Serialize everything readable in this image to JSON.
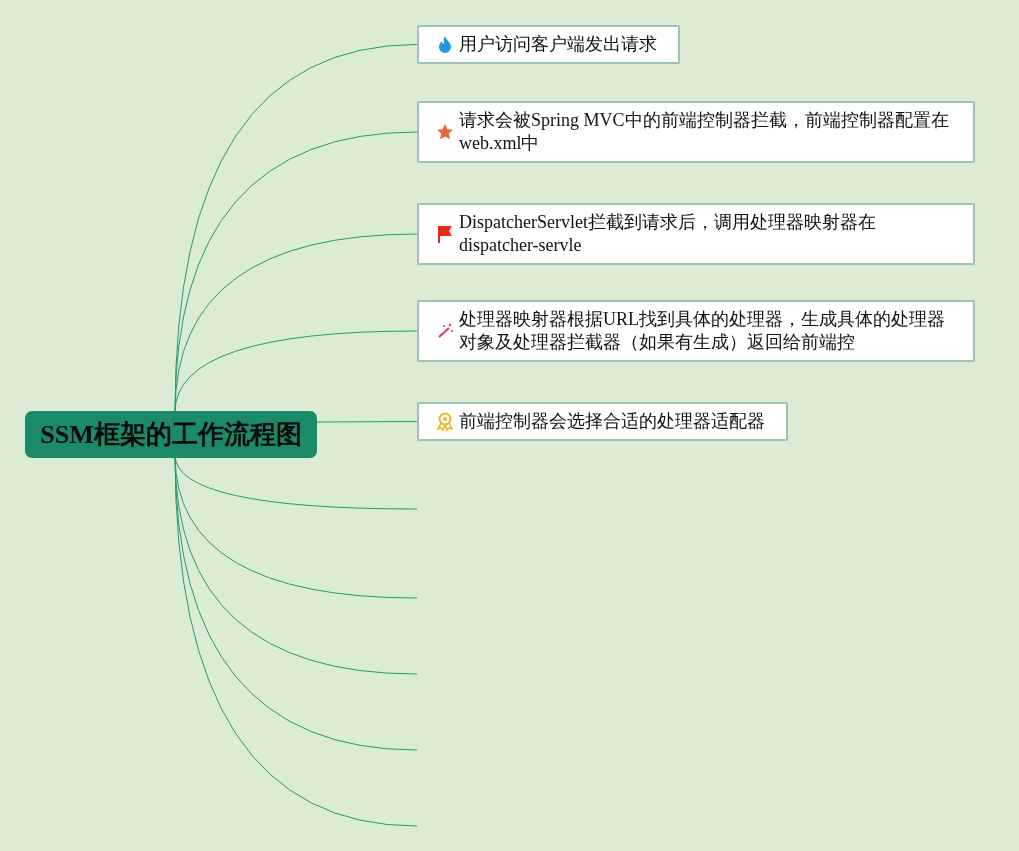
{
  "root": {
    "title": "SSM框架的工作流程图"
  },
  "branches": [
    {
      "kind": "node",
      "text": "用户访问客户端发出请求"
    },
    {
      "kind": "node",
      "text": "请求会被Spring MVC中的前端控制器拦截，前端控制器配置在web.xml中"
    },
    {
      "kind": "node",
      "text": "DispatcherServlet拦截到请求后，调用处理器映射器在dispatcher-servle"
    },
    {
      "kind": "node",
      "text": "处理器映射器根据URL找到具体的处理器，生成具体的处理器对象及处理器拦截器（如果有生成）返回给前端控"
    },
    {
      "kind": "node",
      "text": "前端控制器会选择合适的处理器适配器"
    },
    {
      "kind": "line"
    },
    {
      "kind": "line"
    },
    {
      "kind": "line"
    },
    {
      "kind": "line"
    },
    {
      "kind": "line"
    }
  ]
}
